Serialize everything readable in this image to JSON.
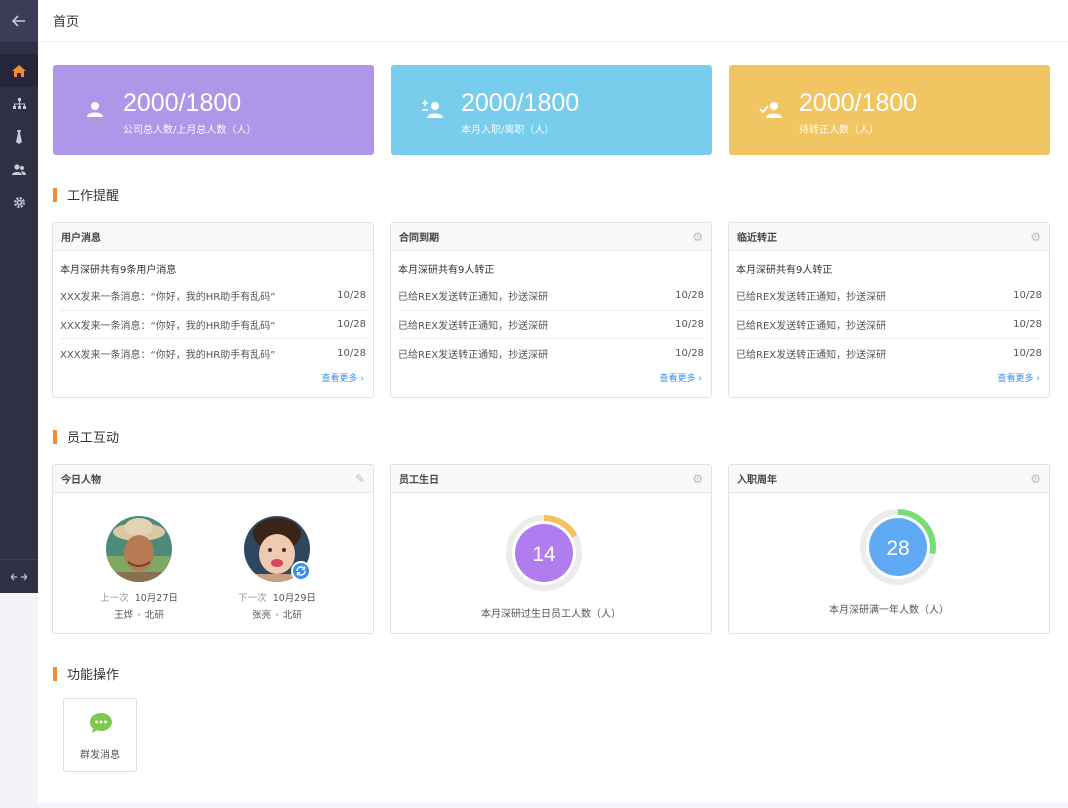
{
  "topbar": {
    "title": "首页"
  },
  "stats": [
    {
      "value": "2000/1800",
      "label": "公司总人数/上月总人数（人）",
      "color": "#ae96e8",
      "icon": "user-icon"
    },
    {
      "value": "2000/1800",
      "label": "本月入职/离职（人）",
      "color": "#78ccec",
      "icon": "user-plus-minus-icon"
    },
    {
      "value": "2000/1800",
      "label": "待转正人数（人）",
      "color": "#f1c562",
      "icon": "user-check-icon"
    }
  ],
  "sections": {
    "work_reminder": "工作提醒",
    "employee_interaction": "员工互动",
    "functions": "功能操作"
  },
  "panels": {
    "user_messages": {
      "title": "用户消息",
      "summary": "本月深研共有9条用户消息",
      "rows": [
        {
          "text": "XXX发来一条消息：“你好，我的HR助手有乱码”",
          "date": "10/28"
        },
        {
          "text": "XXX发来一条消息：“你好，我的HR助手有乱码”",
          "date": "10/28"
        },
        {
          "text": "XXX发来一条消息：“你好，我的HR助手有乱码”",
          "date": "10/28"
        }
      ],
      "more": "查看更多 ›"
    },
    "contract_expiry": {
      "title": "合同到期",
      "summary": "本月深研共有9人转正",
      "rows": [
        {
          "text": "已给REX发送转正通知，抄送深研",
          "date": "10/28"
        },
        {
          "text": "已给REX发送转正通知，抄送深研",
          "date": "10/28"
        },
        {
          "text": "已给REX发送转正通知，抄送深研",
          "date": "10/28"
        }
      ],
      "more": "查看更多 ›"
    },
    "upcoming_regularization": {
      "title": "临近转正",
      "summary": "本月深研共有9人转正",
      "rows": [
        {
          "text": "已给REX发送转正通知，抄送深研",
          "date": "10/28"
        },
        {
          "text": "已给REX发送转正通知，抄送深研",
          "date": "10/28"
        },
        {
          "text": "已给REX发送转正通知，抄送深研",
          "date": "10/28"
        }
      ],
      "more": "查看更多 ›"
    },
    "today_people": {
      "title": "今日人物",
      "people": [
        {
          "when_label": "上一次",
          "date": "10月27日",
          "name": "王烨",
          "dept": "北研"
        },
        {
          "when_label": "下一次",
          "date": "10月29日",
          "name": "张亮",
          "dept": "北研"
        }
      ]
    },
    "birthdays": {
      "title": "员工生日",
      "value": "14",
      "fraction": 0.17,
      "caption": "本月深研过生日员工人数（人）",
      "color": "#b07cf0",
      "arc_color": "#f6c05e"
    },
    "anniversary": {
      "title": "入职周年",
      "value": "28",
      "fraction": 0.28,
      "caption": "本月深研满一年人数（人）",
      "color": "#5fa9f5",
      "arc_color": "#76dc74"
    }
  },
  "functions": [
    {
      "label": "群发消息",
      "icon": "chat-bubble-icon",
      "color": "#7cc94e"
    }
  ],
  "accent_color": "#f28b36"
}
